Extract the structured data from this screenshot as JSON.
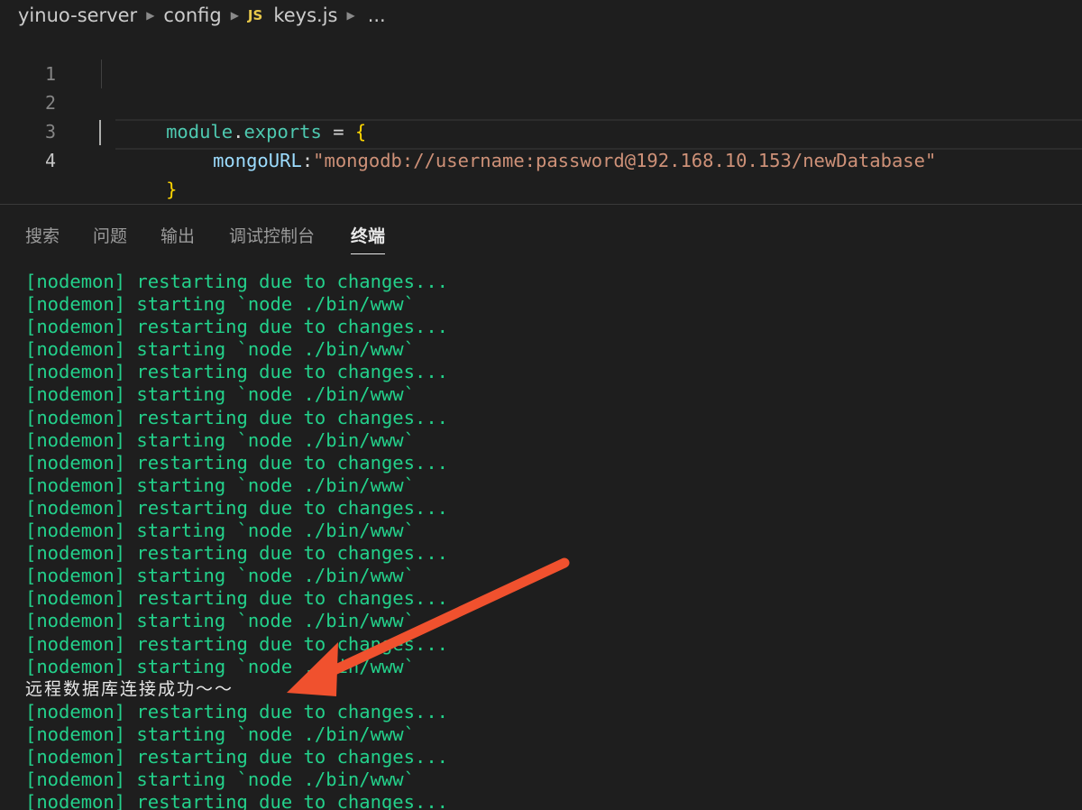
{
  "breadcrumb": {
    "items": [
      "yinuo-server",
      "config"
    ],
    "file_badge": "JS",
    "file_name": "keys.js",
    "ellipsis": "..."
  },
  "editor": {
    "line_numbers": [
      "1",
      "2",
      "3",
      "4"
    ],
    "line1": {
      "obj": "module",
      "dot": ".",
      "prop": "exports",
      "assign": " = ",
      "brace": "{"
    },
    "line2": {
      "key": "mongoURL",
      "colon": ":",
      "value": "\"mongodb://username:password@192.168.10.153/newDatabase\""
    },
    "line3": {
      "brace": "}"
    }
  },
  "panel": {
    "tabs": [
      "搜索",
      "问题",
      "输出",
      "调试控制台",
      "终端"
    ],
    "active_tab": "终端"
  },
  "terminal": {
    "lines": [
      "[nodemon] restarting due to changes...",
      "[nodemon] starting `node ./bin/www`",
      "[nodemon] restarting due to changes...",
      "[nodemon] starting `node ./bin/www`",
      "[nodemon] restarting due to changes...",
      "[nodemon] starting `node ./bin/www`",
      "[nodemon] restarting due to changes...",
      "[nodemon] starting `node ./bin/www`",
      "[nodemon] restarting due to changes...",
      "[nodemon] starting `node ./bin/www`",
      "[nodemon] restarting due to changes...",
      "[nodemon] starting `node ./bin/www`",
      "[nodemon] restarting due to changes...",
      "[nodemon] starting `node ./bin/www`",
      "[nodemon] restarting due to changes...",
      "[nodemon] starting `node ./bin/www`",
      "[nodemon] restarting due to changes...",
      "[nodemon] starting `node ./bin/www`",
      "远程数据库连接成功～～",
      "[nodemon] restarting due to changes...",
      "[nodemon] starting `node ./bin/www`",
      "[nodemon] restarting due to changes...",
      "[nodemon] starting `node ./bin/www`",
      "[nodemon] restarting due to changes..."
    ],
    "highlight_index": 18
  },
  "annotation": {
    "arrow_color": "#f0512e"
  },
  "colors": {
    "terminal_green": "#23d18b",
    "background": "#1e1e1e"
  }
}
